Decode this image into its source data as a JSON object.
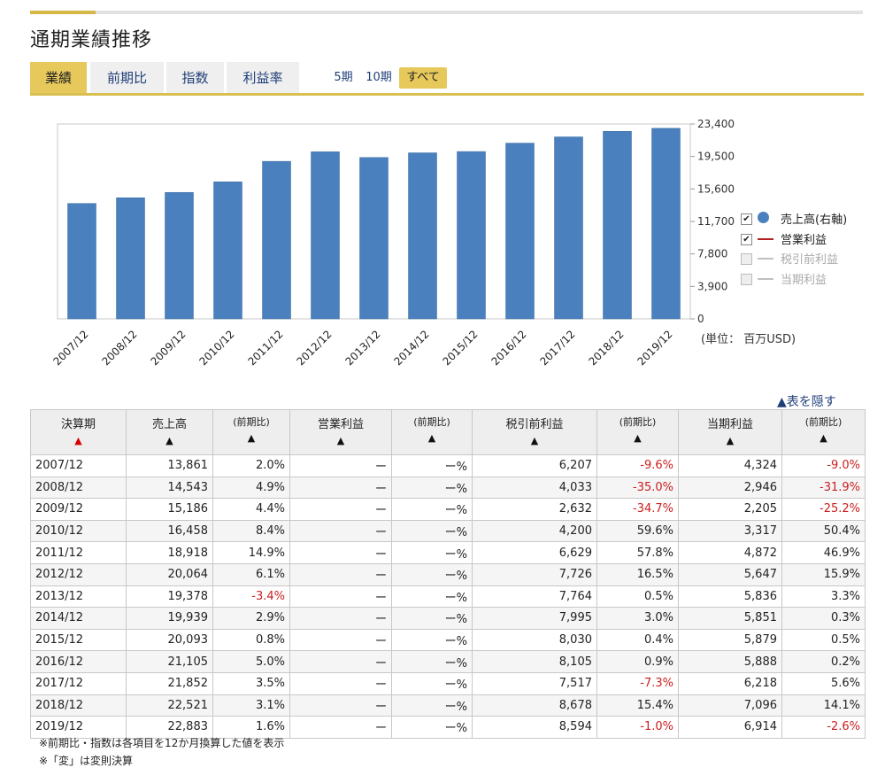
{
  "title": "通期業績推移",
  "tabs": [
    "業績",
    "前期比",
    "指数",
    "利益率"
  ],
  "periods": [
    "5期",
    "10期",
    "すべて"
  ],
  "colors": {
    "accent": "#e6c85b",
    "bar": "#4a80bd",
    "link": "#1f3e78",
    "negative": "#cc1e1e",
    "operating_line": "#b22222"
  },
  "unit_label": "(単位： 百万USD)",
  "legend": [
    {
      "label": "売上高(右軸)",
      "checked": true,
      "marker": "circle",
      "color": "#4a80bd"
    },
    {
      "label": "営業利益",
      "checked": true,
      "marker": "line",
      "color": "#b22222"
    },
    {
      "label": "税引前利益",
      "checked": false,
      "marker": "line",
      "color": "#c0c0c0"
    },
    {
      "label": "当期利益",
      "checked": false,
      "marker": "line",
      "color": "#c0c0c0"
    }
  ],
  "chart_data": {
    "type": "bar",
    "categories": [
      "2007/12",
      "2008/12",
      "2009/12",
      "2010/12",
      "2011/12",
      "2012/12",
      "2013/12",
      "2014/12",
      "2015/12",
      "2016/12",
      "2017/12",
      "2018/12",
      "2019/12"
    ],
    "series": [
      {
        "name": "売上高(右軸)",
        "values": [
          13861,
          14543,
          15186,
          16458,
          18918,
          20064,
          19378,
          19939,
          20093,
          21105,
          21852,
          22521,
          22883
        ]
      }
    ],
    "y_ticks": [
      "0",
      "3,900",
      "7,800",
      "11,700",
      "15,600",
      "19,500",
      "23,400"
    ],
    "ylim": [
      0,
      23400
    ],
    "grid": false,
    "legend_position": "right"
  },
  "hide_table_label": "▲表を隠す",
  "table": {
    "headers": [
      {
        "label": "決算期",
        "arrow": "▲",
        "red": true
      },
      {
        "label": "売上高",
        "arrow": "▲",
        "red": false
      },
      {
        "label": "(前期比)",
        "arrow": "▲",
        "red": false
      },
      {
        "label": "営業利益",
        "arrow": "▲",
        "red": false
      },
      {
        "label": "(前期比)",
        "arrow": "▲",
        "red": false
      },
      {
        "label": "税引前利益",
        "arrow": "▲",
        "red": false
      },
      {
        "label": "(前期比)",
        "arrow": "▲",
        "red": false
      },
      {
        "label": "当期利益",
        "arrow": "▲",
        "red": false
      },
      {
        "label": "(前期比)",
        "arrow": "▲",
        "red": false
      }
    ],
    "rows": [
      [
        "2007/12",
        "13,861",
        "2.0%",
        "ー",
        "ー%",
        "6,207",
        "-9.6%",
        "4,324",
        "-9.0%"
      ],
      [
        "2008/12",
        "14,543",
        "4.9%",
        "ー",
        "ー%",
        "4,033",
        "-35.0%",
        "2,946",
        "-31.9%"
      ],
      [
        "2009/12",
        "15,186",
        "4.4%",
        "ー",
        "ー%",
        "2,632",
        "-34.7%",
        "2,205",
        "-25.2%"
      ],
      [
        "2010/12",
        "16,458",
        "8.4%",
        "ー",
        "ー%",
        "4,200",
        "59.6%",
        "3,317",
        "50.4%"
      ],
      [
        "2011/12",
        "18,918",
        "14.9%",
        "ー",
        "ー%",
        "6,629",
        "57.8%",
        "4,872",
        "46.9%"
      ],
      [
        "2012/12",
        "20,064",
        "6.1%",
        "ー",
        "ー%",
        "7,726",
        "16.5%",
        "5,647",
        "15.9%"
      ],
      [
        "2013/12",
        "19,378",
        "-3.4%",
        "ー",
        "ー%",
        "7,764",
        "0.5%",
        "5,836",
        "3.3%"
      ],
      [
        "2014/12",
        "19,939",
        "2.9%",
        "ー",
        "ー%",
        "7,995",
        "3.0%",
        "5,851",
        "0.3%"
      ],
      [
        "2015/12",
        "20,093",
        "0.8%",
        "ー",
        "ー%",
        "8,030",
        "0.4%",
        "5,879",
        "0.5%"
      ],
      [
        "2016/12",
        "21,105",
        "5.0%",
        "ー",
        "ー%",
        "8,105",
        "0.9%",
        "5,888",
        "0.2%"
      ],
      [
        "2017/12",
        "21,852",
        "3.5%",
        "ー",
        "ー%",
        "7,517",
        "-7.3%",
        "6,218",
        "5.6%"
      ],
      [
        "2018/12",
        "22,521",
        "3.1%",
        "ー",
        "ー%",
        "8,678",
        "15.4%",
        "7,096",
        "14.1%"
      ],
      [
        "2019/12",
        "22,883",
        "1.6%",
        "ー",
        "ー%",
        "8,594",
        "-1.0%",
        "6,914",
        "-2.6%"
      ]
    ]
  },
  "notes": [
    "※前期比・指数は各項目を12か月換算した値を表示",
    "※「変」は変則決算"
  ]
}
